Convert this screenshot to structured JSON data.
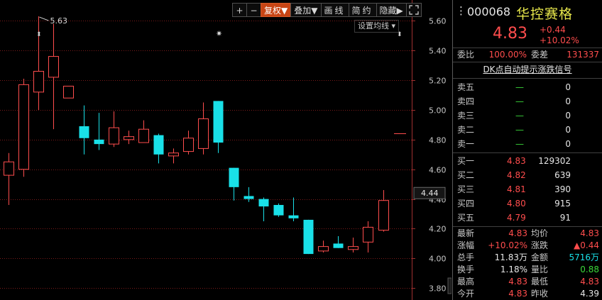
{
  "toolbar": {
    "plus": "+",
    "minus": "−",
    "fuquan": "复权",
    "overlay": "叠加",
    "draw": "画线",
    "brief": "简约",
    "hide": "隐藏",
    "expand_icon": "fullscreen-icon"
  },
  "chart": {
    "set_ma": "设置均线",
    "max_label": "5.63",
    "current_price_tag": "4.44",
    "yticks": [
      "5.60",
      "5.40",
      "5.20",
      "5.00",
      "4.80",
      "4.60",
      "4.40",
      "4.20",
      "4.00",
      "3.80"
    ]
  },
  "chart_data": {
    "type": "candlestick",
    "ylim": [
      3.72,
      5.74
    ],
    "candles": [
      {
        "o": 4.56,
        "h": 4.71,
        "l": 4.36,
        "c": 4.65
      },
      {
        "o": 4.6,
        "h": 5.21,
        "l": 4.55,
        "c": 5.17
      },
      {
        "o": 5.12,
        "h": 5.63,
        "l": 5.0,
        "c": 5.26
      },
      {
        "o": 5.22,
        "h": 5.58,
        "l": 4.87,
        "c": 5.36
      },
      {
        "o": 5.08,
        "h": 5.16,
        "l": 5.11,
        "c": 5.16
      },
      {
        "o": 4.89,
        "h": 5.03,
        "l": 4.7,
        "c": 4.81
      },
      {
        "o": 4.8,
        "h": 4.98,
        "l": 4.73,
        "c": 4.77
      },
      {
        "o": 4.77,
        "h": 4.99,
        "l": 4.75,
        "c": 4.88
      },
      {
        "o": 4.8,
        "h": 4.86,
        "l": 4.77,
        "c": 4.82
      },
      {
        "o": 4.78,
        "h": 4.93,
        "l": 4.78,
        "c": 4.87
      },
      {
        "o": 4.83,
        "h": 4.84,
        "l": 4.64,
        "c": 4.7
      },
      {
        "o": 4.69,
        "h": 4.74,
        "l": 4.64,
        "c": 4.71
      },
      {
        "o": 4.72,
        "h": 4.86,
        "l": 4.7,
        "c": 4.81
      },
      {
        "o": 4.74,
        "h": 5.05,
        "l": 4.7,
        "c": 4.94
      },
      {
        "o": 5.06,
        "h": 5.06,
        "l": 4.71,
        "c": 4.78
      },
      {
        "o": 4.61,
        "h": 4.61,
        "l": 4.39,
        "c": 4.48
      },
      {
        "o": 4.42,
        "h": 4.48,
        "l": 4.38,
        "c": 4.4
      },
      {
        "o": 4.4,
        "h": 4.41,
        "l": 4.25,
        "c": 4.35
      },
      {
        "o": 4.36,
        "h": 4.37,
        "l": 4.28,
        "c": 4.29
      },
      {
        "o": 4.29,
        "h": 4.41,
        "l": 4.25,
        "c": 4.27
      },
      {
        "o": 4.26,
        "h": 4.26,
        "l": 4.03,
        "c": 4.03
      },
      {
        "o": 4.05,
        "h": 4.12,
        "l": 4.04,
        "c": 4.08
      },
      {
        "o": 4.1,
        "h": 4.15,
        "l": 4.07,
        "c": 4.07
      },
      {
        "o": 4.06,
        "h": 4.14,
        "l": 4.04,
        "c": 4.08
      },
      {
        "o": 4.11,
        "h": 4.25,
        "l": 4.04,
        "c": 4.21
      },
      {
        "o": 4.19,
        "h": 4.46,
        "l": 4.18,
        "c": 4.39
      }
    ],
    "ref_line": 4.84
  },
  "quote": {
    "code": "000068",
    "name": "华控赛格",
    "price": "4.83",
    "change": "+0.44",
    "change_pct": "+10.02%",
    "weibi_label": "委比",
    "weibi_value": "100.00%",
    "weicha_label": "委差",
    "weicha_value": "131337",
    "banner": "DK点自动提示涨跌信号",
    "asks": [
      {
        "label": "卖五",
        "price": "—",
        "vol": "0"
      },
      {
        "label": "卖四",
        "price": "—",
        "vol": "0"
      },
      {
        "label": "卖三",
        "price": "—",
        "vol": "0"
      },
      {
        "label": "卖二",
        "price": "—",
        "vol": "0"
      },
      {
        "label": "卖一",
        "price": "—",
        "vol": "0"
      }
    ],
    "bids": [
      {
        "label": "买一",
        "price": "4.83",
        "vol": "129302"
      },
      {
        "label": "买二",
        "price": "4.82",
        "vol": "639"
      },
      {
        "label": "买三",
        "price": "4.81",
        "vol": "390"
      },
      {
        "label": "买四",
        "price": "4.80",
        "vol": "915"
      },
      {
        "label": "买五",
        "price": "4.79",
        "vol": "91"
      }
    ],
    "stats": [
      {
        "l1": "最新",
        "v1": "4.83",
        "c1": "red",
        "l2": "均价",
        "v2": "4.83",
        "c2": "red"
      },
      {
        "l1": "涨幅",
        "v1": "+10.02%",
        "c1": "red",
        "l2": "涨跌",
        "v2": "▲0.44",
        "c2": "red"
      },
      {
        "l1": "总手",
        "v1": "11.83万",
        "c1": "white",
        "l2": "金额",
        "v2": "5716万",
        "c2": "cyan"
      },
      {
        "l1": "换手",
        "v1": "1.18%",
        "c1": "white",
        "l2": "量比",
        "v2": "0.88",
        "c2": "green"
      },
      {
        "l1": "最高",
        "v1": "4.83",
        "c1": "red",
        "l2": "最低",
        "v2": "4.83",
        "c2": "red"
      },
      {
        "l1": "今开",
        "v1": "4.83",
        "c1": "red",
        "l2": "昨收",
        "v2": "4.39",
        "c2": "white"
      }
    ]
  },
  "colors": {
    "up": "#ff4d4d",
    "down": "#19e0e8",
    "grid": "#7a1a1a"
  }
}
